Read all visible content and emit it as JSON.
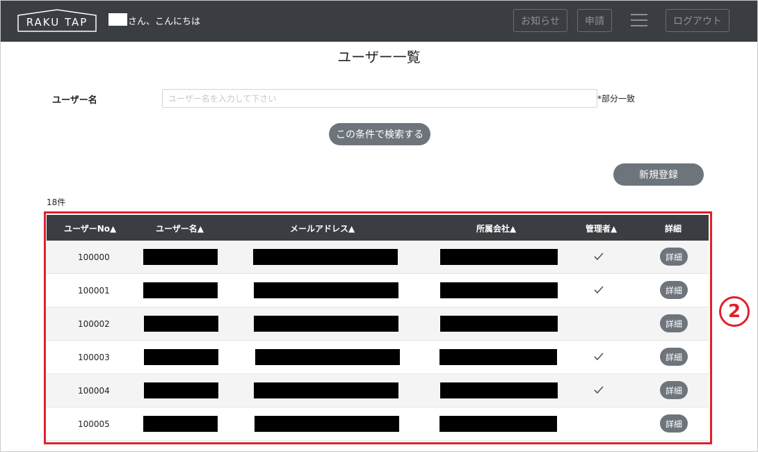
{
  "header": {
    "logo_text": "RAKU TAP",
    "greeting": "さん、こんにちは",
    "notice_label": "お知らせ",
    "apply_label": "申請",
    "logout_label": "ログアウト"
  },
  "page": {
    "title": "ユーザー一覧"
  },
  "search": {
    "label": "ユーザー名",
    "placeholder": "ユーザー名を入力して下さい",
    "note": "*部分一致",
    "submit_label": "この条件で検索する"
  },
  "actions": {
    "register_label": "新規登録"
  },
  "results": {
    "count": "18件"
  },
  "table": {
    "headers": [
      "ユーザーNo▲",
      "ユーザー名▲",
      "メールアドレス▲",
      "所属会社▲",
      "管理者▲",
      "詳細"
    ],
    "detail_label": "詳細",
    "rows": [
      {
        "user_no": "100000",
        "admin": true
      },
      {
        "user_no": "100001",
        "admin": true
      },
      {
        "user_no": "100002",
        "admin": false
      },
      {
        "user_no": "100003",
        "admin": true
      },
      {
        "user_no": "100004",
        "admin": true
      },
      {
        "user_no": "100005",
        "admin": false
      }
    ]
  },
  "annotation": {
    "callout": "2",
    "color": "#e0202a"
  },
  "colors": {
    "header_bg": "#3a3d41",
    "button_bg": "#6e747b"
  }
}
